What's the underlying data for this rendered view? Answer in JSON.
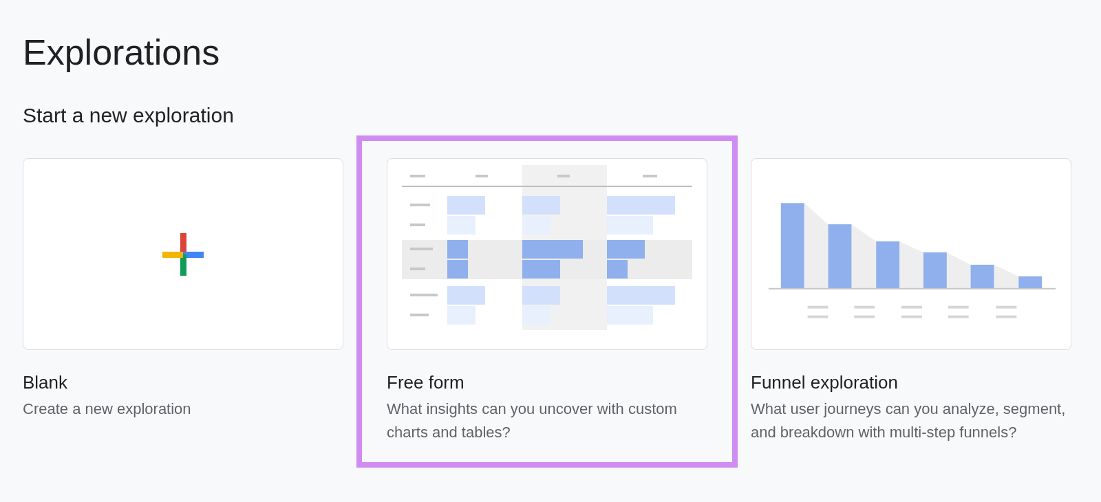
{
  "page": {
    "title": "Explorations",
    "subtitle": "Start a new exploration"
  },
  "templates": [
    {
      "kind": "blank",
      "title": "Blank",
      "description": "Create a new exploration",
      "highlighted": false
    },
    {
      "kind": "table",
      "title": "Free form",
      "description": "What insights can you uncover with custom charts and tables?",
      "highlighted": true
    },
    {
      "kind": "funnel",
      "title": "Funnel exploration",
      "description": "What user journeys can you analyze, segment, and breakdown with multi-step funnels?",
      "highlighted": false
    }
  ]
}
